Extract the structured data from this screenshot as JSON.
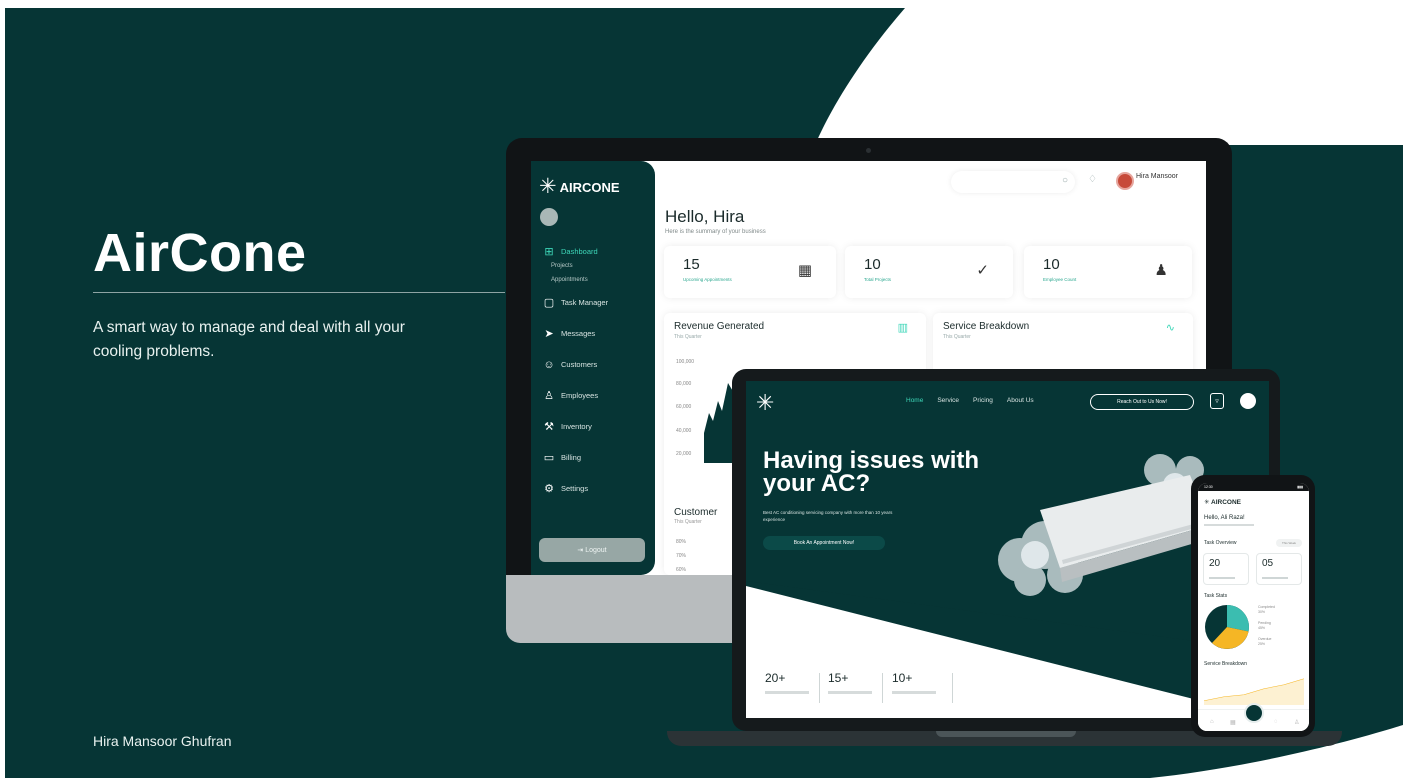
{
  "colors": {
    "brand_dark": "#063535",
    "accent": "#3dd6b8",
    "white": "#ffffff"
  },
  "hero": {
    "title": "AirCone",
    "subtitle": "A smart way to manage and deal with all your cooling problems.",
    "author": "Hira Mansoor Ghufran"
  },
  "dashboard": {
    "logo_text": "AIRCONE",
    "user_name": "Hira Mansoor",
    "greeting": "Hello, Hira",
    "greeting_sub": "Here is the summary of your business",
    "nav": {
      "dashboard": "Dashboard",
      "projects": "Projects",
      "appointments": "Appointments",
      "task_manager": "Task Manager",
      "messages": "Messages",
      "customers": "Customers",
      "employees": "Employees",
      "inventory": "Inventory",
      "billing": "Billing",
      "settings": "Settings"
    },
    "logout": "Logout",
    "stats": [
      {
        "value": "15",
        "label": "Upcoming Appointments",
        "icon": "calendar-icon"
      },
      {
        "value": "10",
        "label": "Total Projects",
        "icon": "check-circle-icon"
      },
      {
        "value": "10",
        "label": "Employee Count",
        "icon": "user-check-icon"
      }
    ],
    "revenue": {
      "title": "Revenue Generated",
      "subtitle": "This Quarter"
    },
    "service": {
      "title": "Service Breakdown",
      "subtitle": "This Quarter"
    },
    "customer": {
      "title": "Customer",
      "subtitle": "This Quarter"
    },
    "revenue_axis": [
      "100,000",
      "80,000",
      "60,000",
      "40,000",
      "20,000"
    ],
    "customer_axis": [
      "80%",
      "70%",
      "60%"
    ]
  },
  "website": {
    "nav": [
      "Home",
      "Service",
      "Pricing",
      "About Us"
    ],
    "active_nav": "Home",
    "cta": "Reach Out to Us Now!",
    "headline": "Having issues with your AC?",
    "description": "Best AC conditioning servicing company with more than 10 years experience",
    "book_button": "Book An Appointment Now!",
    "stats": [
      "20+",
      "15+",
      "10+"
    ]
  },
  "mobile": {
    "status_time": "12:30",
    "logo_text": "AIRCONE",
    "greeting": "Hello, Ali Raza!",
    "task_overview": "Task Overview",
    "filter": "This Week",
    "cards": [
      "20",
      "05"
    ],
    "task_stats": "Task Stats",
    "legend": [
      {
        "name": "Completed",
        "value": "30%"
      },
      {
        "name": "Pending",
        "value": "45%"
      },
      {
        "name": "Overdue",
        "value": "25%"
      }
    ],
    "service_breakdown": "Service Breakdown"
  }
}
